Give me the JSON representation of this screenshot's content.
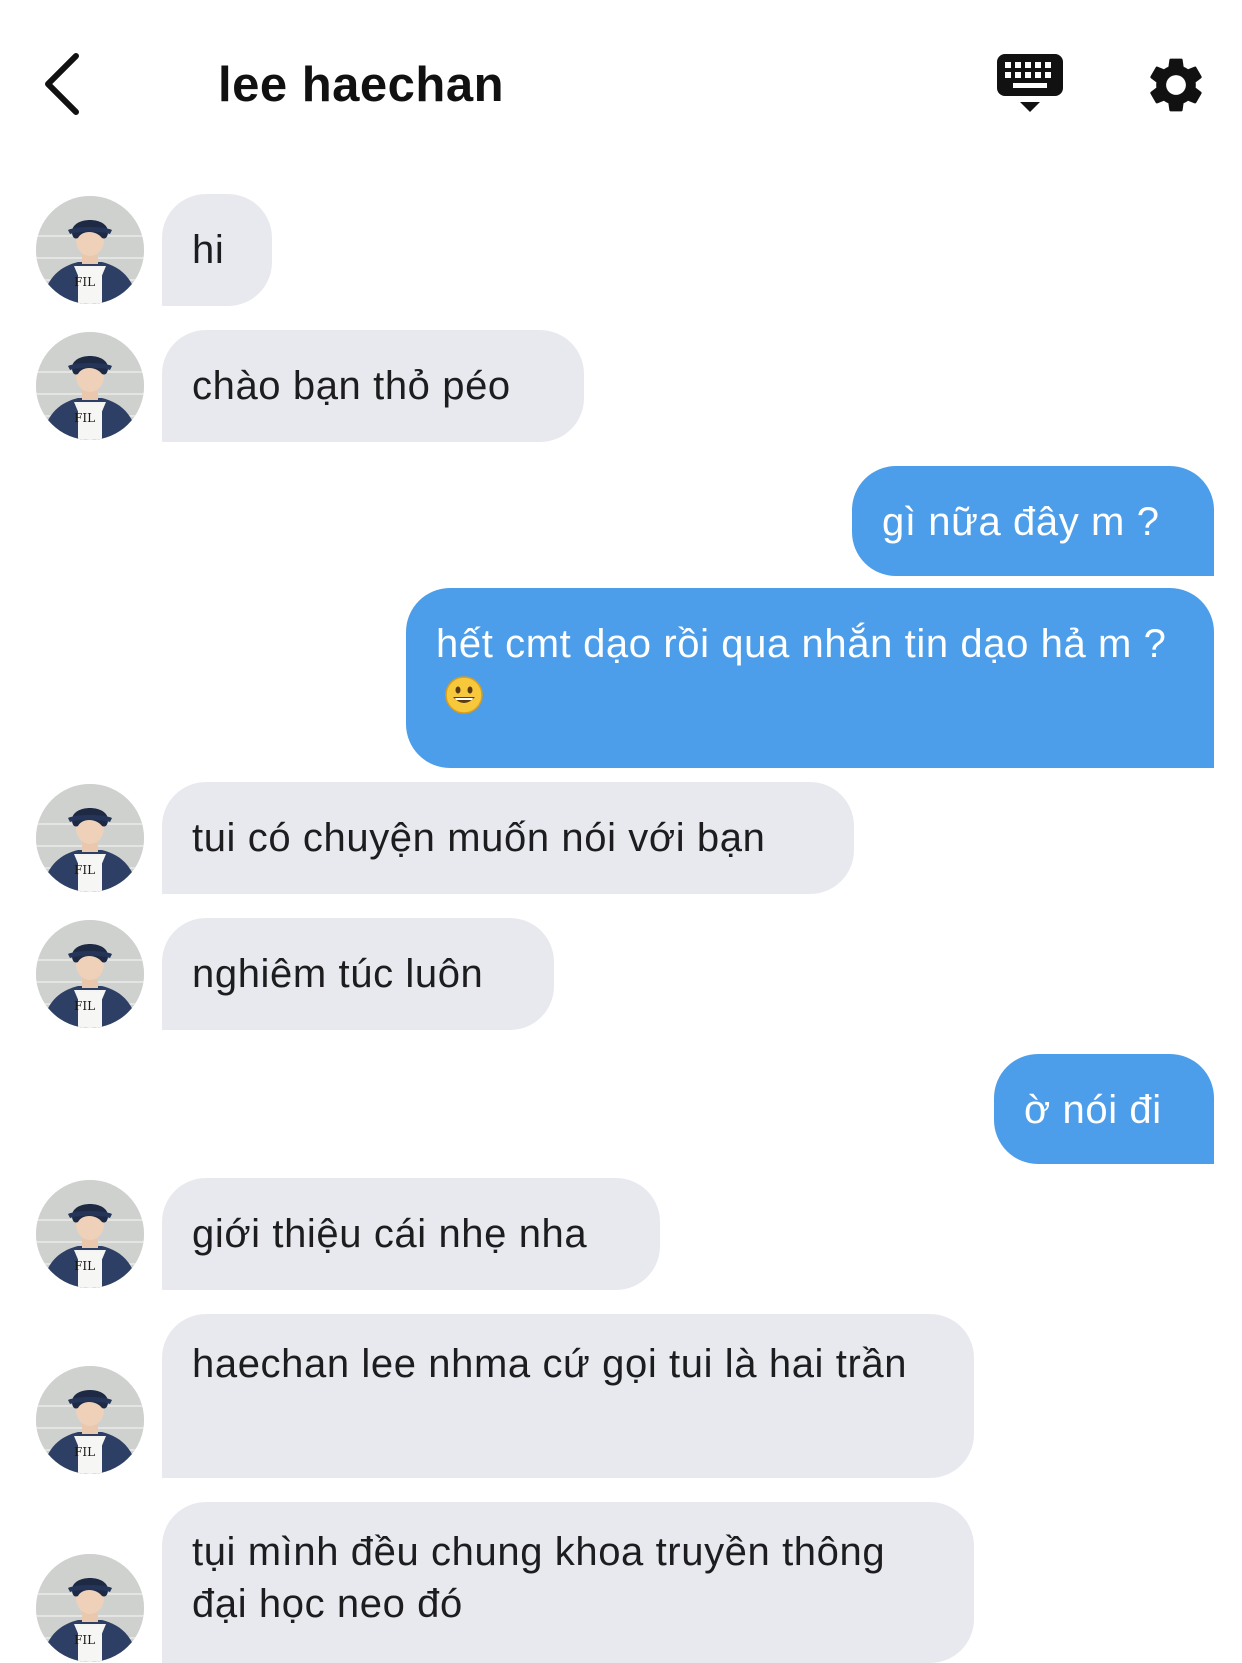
{
  "header": {
    "title": "lee haechan"
  },
  "messages": [
    {
      "from": "them",
      "text": "hi"
    },
    {
      "from": "them",
      "text": "chào bạn thỏ péo"
    },
    {
      "from": "me",
      "text": "gì nữa đây m ?"
    },
    {
      "from": "me",
      "text": "hết cmt dạo rồi qua nhắn tin dạo hả m ?",
      "emoji": "grinning-face-emoji"
    },
    {
      "from": "them",
      "text": "tui có chuyện muốn nói với bạn"
    },
    {
      "from": "them",
      "text": "nghiêm túc luôn"
    },
    {
      "from": "me",
      "text": "ờ nói đi"
    },
    {
      "from": "them",
      "text": "giới thiệu cái nhẹ nha"
    },
    {
      "from": "them",
      "text": "haechan lee nhma cứ gọi tui là hai trần"
    },
    {
      "from": "them",
      "text": "tụi mình đều chung khoa truyền thông đại học neo đó"
    }
  ],
  "colors": {
    "incoming_bubble": "#e7e9ee",
    "outgoing_bubble": "#4d9eea",
    "outgoing_text": "#ffffff"
  },
  "icons": {
    "back": "chevron-left-icon",
    "keyboard": "keyboard-icon",
    "settings": "gear-icon",
    "avatar": "avatar"
  }
}
